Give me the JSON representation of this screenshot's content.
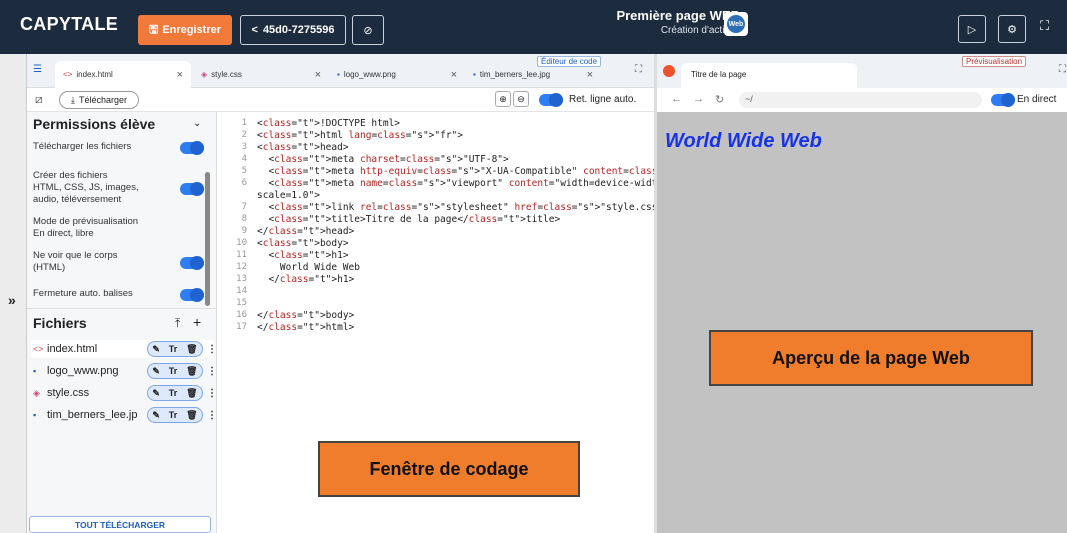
{
  "topbar": {
    "logo": "CAPYTALE",
    "save_label": "Enregistrer",
    "share_code": "45d0-7275596",
    "title": "Première page WEB",
    "subtitle": "Création d'activité",
    "badge": "Web"
  },
  "editor": {
    "tabs": [
      {
        "label": "index.html",
        "icon": "<>"
      },
      {
        "label": "style.css",
        "icon": "css-icon"
      },
      {
        "label": "logo_www.png",
        "icon": "image-icon"
      },
      {
        "label": "tim_berners_lee.jpg",
        "icon": "image-icon"
      }
    ],
    "panel_label": "Éditeur de code",
    "download_label": "Télécharger",
    "wrap_label": "Ret. ligne auto."
  },
  "sidebar": {
    "permissions_title": "Permissions élève",
    "permissions": [
      {
        "label": "Télécharger les fichiers",
        "on": true
      },
      {
        "label": "Créer des fichiers",
        "sub": "HTML, CSS, JS, images,",
        "sub2": "audio, téléversement",
        "on": true
      },
      {
        "label": "Mode de prévisualisation",
        "sub": "En direct, libre",
        "on": false
      },
      {
        "label": "Ne voir que le corps",
        "sub": "(HTML)",
        "on": true
      },
      {
        "label": "Fermeture auto. balises",
        "on": true
      }
    ],
    "files_title": "Fichiers",
    "files": [
      "index.html",
      "logo_www.png",
      "style.css",
      "tim_berners_lee.jp"
    ],
    "download_all": "TOUT TÉLÉCHARGER"
  },
  "code_lines": [
    "<!DOCTYPE html>",
    "<html lang=\"fr\">",
    "<head>",
    "  <meta charset=\"UTF-8\">",
    "  <meta http-equiv=\"X-UA-Compatible\" content=\"IE=edge\">",
    "  <meta name=\"viewport\" content=\"width=device-width, initial-",
    "scale=1.0\">",
    "  <link rel=\"stylesheet\" href=\"style.css\">",
    "  <title>Titre de la page</title>",
    "</head>",
    "<body>",
    "  <h1>",
    "    World Wide Web",
    "  </h1>",
    "",
    "",
    "</body>",
    "</html>"
  ],
  "line_numbers": [
    "1",
    "2",
    "3",
    "4",
    "5",
    "6",
    "",
    "7",
    "8",
    "9",
    "10",
    "11",
    "12",
    "13",
    "14",
    "15",
    "16",
    "17"
  ],
  "preview": {
    "tab_title": "Titre de la page",
    "panel_label": "Prévisualisation",
    "url": "~/",
    "live_label": "En direct",
    "h1": "World Wide Web"
  },
  "callouts": {
    "code": "Fenêtre de codage",
    "preview": "Aperçu de la page Web"
  },
  "colors": {
    "topbar": "#1c2b3d",
    "accent": "#f1793a",
    "callout": "#ef7d2c",
    "preview_bg": "#c2c2c2",
    "h1": "#1733e8"
  }
}
